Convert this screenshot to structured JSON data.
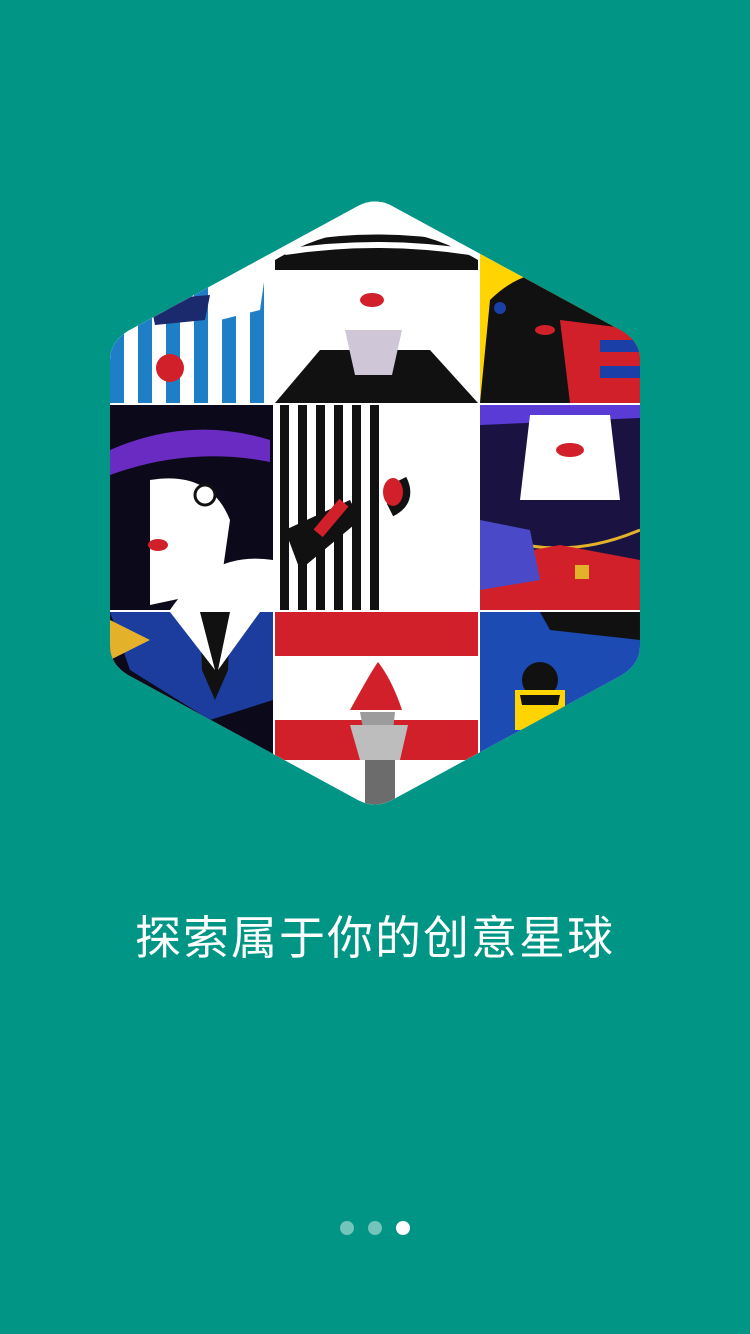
{
  "onboarding": {
    "tagline": "探索属于你的创意星球",
    "image_alt": "hexagon-fashion-illustration-collage",
    "page_indicator": {
      "total": 3,
      "active_index": 2
    }
  },
  "colors": {
    "background": "#009584",
    "dot_active": "#ffffff",
    "dot_inactive": "rgba(255,255,255,0.45)"
  }
}
